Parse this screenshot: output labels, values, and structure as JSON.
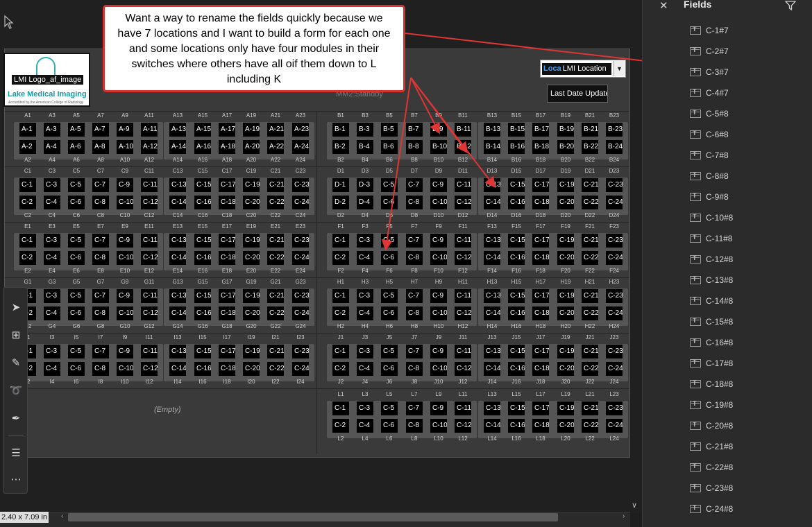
{
  "fields_panel": {
    "title": "Fields",
    "items": [
      "C-1#7",
      "C-2#7",
      "C-3#7",
      "C-4#7",
      "C-5#8",
      "C-6#8",
      "C-7#8",
      "C-8#8",
      "C-9#8",
      "C-10#8",
      "C-11#8",
      "C-12#8",
      "C-13#8",
      "C-14#8",
      "C-15#8",
      "C-16#8",
      "C-17#8",
      "C-18#8",
      "C-19#8",
      "C-20#8",
      "C-21#8",
      "C-22#8",
      "C-23#8",
      "C-24#8"
    ]
  },
  "annotation": {
    "text": "Want a way to rename the fields quickly because we have 7 locations and I want to build a form for each one and some locations only have four modules in their switches where others have all oif them down to L including K"
  },
  "logo": {
    "label": "LMI Logo_af_image",
    "name": "Lake Medical Imaging",
    "sub": "Accredited by the American College of Radiology"
  },
  "location_dropdown": {
    "prefix": "Loca",
    "value": "LMI Location"
  },
  "last_date_button": "Last Date Update",
  "mm2_checkbox": "MM2:Standby",
  "empty_label": "(Empty)",
  "status": {
    "page_dimensions": "2.40 x 7.09 in"
  },
  "switch_rows": [
    {
      "letter": "A",
      "top_labels": [
        "A1",
        "A3",
        "A5",
        "A7",
        "A9",
        "A11",
        "A13",
        "A15",
        "A17",
        "A19",
        "A21",
        "A23"
      ],
      "bottom_labels": [
        "A2",
        "A4",
        "A6",
        "A8",
        "A10",
        "A12",
        "A14",
        "A16",
        "A18",
        "A20",
        "A22",
        "A24"
      ],
      "top_ports": [
        "A-1",
        "A-3",
        "A-5",
        "A-7",
        "A-9",
        "A-11",
        "A-13",
        "A-15",
        "A-17",
        "A-19",
        "A-21",
        "A-23"
      ],
      "bottom_ports": [
        "A-2",
        "A-4",
        "A-6",
        "A-8",
        "A-10",
        "A-12",
        "A-14",
        "A-16",
        "A-18",
        "A-20",
        "A-22",
        "A-24"
      ]
    },
    {
      "letter": "B",
      "top_labels": [
        "B1",
        "B3",
        "B5",
        "B7",
        "B9",
        "B11",
        "B13",
        "B15",
        "B17",
        "B19",
        "B21",
        "B23"
      ],
      "bottom_labels": [
        "B2",
        "B4",
        "B6",
        "B8",
        "B10",
        "B12",
        "B14",
        "B16",
        "B18",
        "B20",
        "B22",
        "B24"
      ],
      "top_ports": [
        "B-1",
        "B-3",
        "B-5",
        "B-7",
        "B-9",
        "B-11",
        "B-13",
        "B-15",
        "B-17",
        "B-19",
        "B-21",
        "B-23"
      ],
      "bottom_ports": [
        "B-2",
        "B-4",
        "B-6",
        "B-8",
        "B-10",
        "B-12",
        "B-14",
        "B-16",
        "B-18",
        "B-20",
        "B-22",
        "B-24"
      ]
    },
    {
      "letter": "C",
      "top_labels": [
        "C1",
        "C3",
        "C5",
        "C7",
        "C9",
        "C11",
        "C13",
        "C15",
        "C17",
        "C19",
        "C21",
        "C23"
      ],
      "bottom_labels": [
        "C2",
        "C4",
        "C6",
        "C8",
        "C10",
        "C12",
        "C14",
        "C16",
        "C18",
        "C20",
        "C22",
        "C24"
      ],
      "top_ports": [
        "C-1",
        "C-3",
        "C-5",
        "C-7",
        "C-9",
        "C-11",
        "C-13",
        "C-15",
        "C-17",
        "C-19",
        "C-21",
        "C-23"
      ],
      "bottom_ports": [
        "C-2",
        "C-4",
        "C-6",
        "C-8",
        "C-10",
        "C-12",
        "C-14",
        "C-16",
        "C-18",
        "C-20",
        "C-22",
        "C-24"
      ]
    },
    {
      "letter": "D",
      "top_labels": [
        "D1",
        "D3",
        "D5",
        "D7",
        "D9",
        "D11",
        "D13",
        "D15",
        "D17",
        "D19",
        "D21",
        "D23"
      ],
      "bottom_labels": [
        "D2",
        "D4",
        "D6",
        "D8",
        "D10",
        "D12",
        "D14",
        "D16",
        "D18",
        "D20",
        "D22",
        "D24"
      ],
      "top_ports": [
        "D-1",
        "D-3",
        "C-5",
        "C-7",
        "C-9",
        "C-11",
        "C-13",
        "C-15",
        "C-17",
        "C-19",
        "C-21",
        "C-23"
      ],
      "bottom_ports": [
        "D-2",
        "D-4",
        "C-6",
        "C-8",
        "C-10",
        "C-12",
        "C-14",
        "C-16",
        "C-18",
        "C-20",
        "C-22",
        "C-24"
      ]
    },
    {
      "letter": "E",
      "top_labels": [
        "E1",
        "E3",
        "E5",
        "E7",
        "E9",
        "E11",
        "E13",
        "E15",
        "E17",
        "E19",
        "E21",
        "E23"
      ],
      "bottom_labels": [
        "E2",
        "E4",
        "E6",
        "E8",
        "E10",
        "E12",
        "E14",
        "E16",
        "E18",
        "E20",
        "E22",
        "E24"
      ],
      "top_ports": [
        "C-1",
        "C-3",
        "C-5",
        "C-7",
        "C-9",
        "C-11",
        "C-13",
        "C-15",
        "C-17",
        "C-19",
        "C-21",
        "C-23"
      ],
      "bottom_ports": [
        "C-2",
        "C-4",
        "C-6",
        "C-8",
        "C-10",
        "C-12",
        "C-14",
        "C-16",
        "C-18",
        "C-20",
        "C-22",
        "C-24"
      ]
    },
    {
      "letter": "F",
      "top_labels": [
        "F1",
        "F3",
        "F5",
        "F7",
        "F9",
        "F11",
        "F13",
        "F15",
        "F17",
        "F19",
        "F21",
        "F23"
      ],
      "bottom_labels": [
        "F2",
        "F4",
        "F6",
        "F8",
        "F10",
        "F12",
        "F14",
        "F16",
        "F18",
        "F20",
        "F22",
        "F24"
      ],
      "top_ports": [
        "C-1",
        "C-3",
        "C-5",
        "C-7",
        "C-9",
        "C-11",
        "C-13",
        "C-15",
        "C-17",
        "C-19",
        "C-21",
        "C-23"
      ],
      "bottom_ports": [
        "C-2",
        "C-4",
        "C-6",
        "C-8",
        "C-10",
        "C-12",
        "C-14",
        "C-16",
        "C-18",
        "C-20",
        "C-22",
        "C-24"
      ]
    },
    {
      "letter": "G",
      "top_labels": [
        "G1",
        "G3",
        "G5",
        "G7",
        "G9",
        "G11",
        "G13",
        "G15",
        "G17",
        "G19",
        "G21",
        "G23"
      ],
      "bottom_labels": [
        "G2",
        "G4",
        "G6",
        "G8",
        "G10",
        "G12",
        "G14",
        "G16",
        "G18",
        "G20",
        "G22",
        "G24"
      ],
      "top_ports": [
        "C-1",
        "C-3",
        "C-5",
        "C-7",
        "C-9",
        "C-11",
        "C-13",
        "C-15",
        "C-17",
        "C-19",
        "C-21",
        "C-23"
      ],
      "bottom_ports": [
        "C-2",
        "C-4",
        "C-6",
        "C-8",
        "C-10",
        "C-12",
        "C-14",
        "C-16",
        "C-18",
        "C-20",
        "C-22",
        "C-24"
      ]
    },
    {
      "letter": "H",
      "top_labels": [
        "H1",
        "H3",
        "H5",
        "H7",
        "H9",
        "H11",
        "H13",
        "H15",
        "H17",
        "H19",
        "H21",
        "H23"
      ],
      "bottom_labels": [
        "H2",
        "H4",
        "H6",
        "H8",
        "H10",
        "H12",
        "H14",
        "H16",
        "H18",
        "H20",
        "H22",
        "H24"
      ],
      "top_ports": [
        "C-1",
        "C-3",
        "C-5",
        "C-7",
        "C-9",
        "C-11",
        "C-13",
        "C-15",
        "C-17",
        "C-19",
        "C-21",
        "C-23"
      ],
      "bottom_ports": [
        "C-2",
        "C-4",
        "C-6",
        "C-8",
        "C-10",
        "C-12",
        "C-14",
        "C-16",
        "C-18",
        "C-20",
        "C-22",
        "C-24"
      ]
    },
    {
      "letter": "I",
      "top_labels": [
        "I1",
        "I3",
        "I5",
        "I7",
        "I9",
        "I11",
        "I13",
        "I15",
        "I17",
        "I19",
        "I21",
        "I23"
      ],
      "bottom_labels": [
        "I2",
        "I4",
        "I6",
        "I8",
        "I10",
        "I12",
        "I14",
        "I16",
        "I18",
        "I20",
        "I22",
        "I24"
      ],
      "top_ports": [
        "C-1",
        "C-3",
        "C-5",
        "C-7",
        "C-9",
        "C-11",
        "C-13",
        "C-15",
        "C-17",
        "C-19",
        "C-21",
        "C-23"
      ],
      "bottom_ports": [
        "C-2",
        "C-4",
        "C-6",
        "C-8",
        "C-10",
        "C-12",
        "C-14",
        "C-16",
        "C-18",
        "C-20",
        "C-22",
        "C-24"
      ]
    },
    {
      "letter": "J",
      "top_labels": [
        "J1",
        "J3",
        "J5",
        "J7",
        "J9",
        "J11",
        "J13",
        "J15",
        "J17",
        "J19",
        "J21",
        "J23"
      ],
      "bottom_labels": [
        "J2",
        "J4",
        "J6",
        "J8",
        "J10",
        "J12",
        "J14",
        "J16",
        "J18",
        "J20",
        "J22",
        "J24"
      ],
      "top_ports": [
        "C-1",
        "C-3",
        "C-5",
        "C-7",
        "C-9",
        "C-11",
        "C-13",
        "C-15",
        "C-17",
        "C-19",
        "C-21",
        "C-23"
      ],
      "bottom_ports": [
        "C-2",
        "C-4",
        "C-6",
        "C-8",
        "C-10",
        "C-12",
        "C-14",
        "C-16",
        "C-18",
        "C-20",
        "C-22",
        "C-24"
      ]
    },
    {
      "letter": "L",
      "top_labels": [
        "L1",
        "L3",
        "L5",
        "L7",
        "L9",
        "L11",
        "L13",
        "L15",
        "L17",
        "L19",
        "L21",
        "L23"
      ],
      "bottom_labels": [
        "L2",
        "L4",
        "L6",
        "L8",
        "L10",
        "L12",
        "L14",
        "L16",
        "L18",
        "L20",
        "L22",
        "L24"
      ],
      "top_ports": [
        "C-1",
        "C-3",
        "C-5",
        "C-7",
        "C-9",
        "C-11",
        "C-13",
        "C-15",
        "C-17",
        "C-19",
        "C-21",
        "C-23"
      ],
      "bottom_ports": [
        "C-2",
        "C-4",
        "C-6",
        "C-8",
        "C-10",
        "C-12",
        "C-14",
        "C-16",
        "C-18",
        "C-20",
        "C-22",
        "C-24"
      ]
    }
  ],
  "toolbar": {
    "tools": [
      "select-tool-icon",
      "add-comment-icon",
      "highlight-pen-icon",
      "lasso-icon",
      "sign-pen-icon",
      "form-edit-icon",
      "more-tools-icon"
    ]
  }
}
